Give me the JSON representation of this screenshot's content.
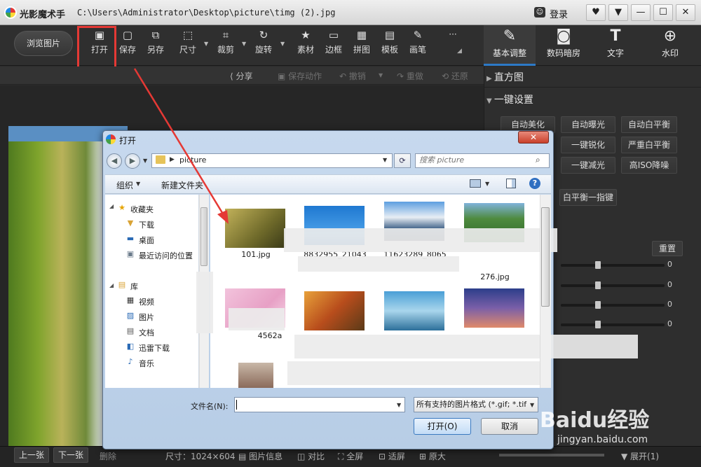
{
  "window": {
    "app_name": "光影魔术手",
    "file_path": "C:\\Users\\Administrator\\Desktop\\picture\\timg (2).jpg",
    "login": "登录",
    "controls": [
      "♥",
      "▼",
      "—",
      "☐",
      "✕"
    ]
  },
  "toolbar": {
    "browse": "浏览图片",
    "tools": [
      {
        "label": "打开",
        "icon": "open-image-icon"
      },
      {
        "label": "保存",
        "icon": "save-icon"
      },
      {
        "label": "另存",
        "icon": "save-as-icon"
      },
      {
        "label": "尺寸",
        "icon": "resize-icon"
      },
      {
        "label": "裁剪",
        "icon": "crop-icon"
      },
      {
        "label": "旋转",
        "icon": "rotate-icon"
      },
      {
        "label": "素材",
        "icon": "material-icon"
      },
      {
        "label": "边框",
        "icon": "border-icon"
      },
      {
        "label": "拼图",
        "icon": "collage-icon"
      },
      {
        "label": "模板",
        "icon": "template-icon"
      },
      {
        "label": "画笔",
        "icon": "brush-icon"
      },
      {
        "label": "···",
        "icon": "more-icon"
      }
    ],
    "right_tabs": [
      {
        "label": "基本调整",
        "icon": "adjust-icon"
      },
      {
        "label": "数码暗房",
        "icon": "camera-icon"
      },
      {
        "label": "文字",
        "icon": "text-icon"
      },
      {
        "label": "水印",
        "icon": "watermark-icon"
      }
    ]
  },
  "subbar": {
    "share": "分享",
    "save_action": "保存动作",
    "undo": "撤销",
    "redo": "重做",
    "restore": "还原"
  },
  "panel": {
    "histogram": "直方图",
    "one_click": "一键设置",
    "buttons": [
      "自动美化",
      "自动曝光",
      "自动白平衡",
      "一键锐化",
      "严重白平衡",
      "一键减光",
      "高ISO降噪",
      "白平衡一指键"
    ],
    "reset": "重置",
    "slider_values": [
      "0",
      "0",
      "0",
      "0"
    ]
  },
  "bottombar": {
    "prev": "上一张",
    "next": "下一张",
    "delete": "删除",
    "size": "尺寸：1024×604",
    "info": "图片信息",
    "compare": "对比",
    "fullscreen": "全屏",
    "fit": "适屏",
    "actual": "原大",
    "expand": "展开(1)"
  },
  "watermark": {
    "brand": "Baidu经验",
    "url": "jingyan.baidu.com"
  },
  "dialog": {
    "title": "打开",
    "close": "✕",
    "path_folder": "picture",
    "search_placeholder": "搜索 picture",
    "organize": "组织",
    "new_folder": "新建文件夹",
    "nav": [
      {
        "label": "收藏夹",
        "icon": "star-icon",
        "indent": false
      },
      {
        "label": "下载",
        "icon": "download-folder-icon",
        "indent": true
      },
      {
        "label": "桌面",
        "icon": "desktop-icon",
        "indent": true
      },
      {
        "label": "最近访问的位置",
        "icon": "recent-icon",
        "indent": true
      },
      {
        "label": "库",
        "icon": "library-icon",
        "indent": false
      },
      {
        "label": "视频",
        "icon": "video-icon",
        "indent": true
      },
      {
        "label": "图片",
        "icon": "pictures-icon",
        "indent": true
      },
      {
        "label": "文档",
        "icon": "documents-icon",
        "indent": true
      },
      {
        "label": "迅雷下载",
        "icon": "thunder-download-icon",
        "indent": true
      },
      {
        "label": "音乐",
        "icon": "music-icon",
        "indent": true
      }
    ],
    "files": [
      {
        "name": "101.jpg",
        "color": "#8a8a3a"
      },
      {
        "name": "8832955_21043",
        "color": "#2a7bc8"
      },
      {
        "name": "11623289_8065",
        "color": "#5d86b5"
      },
      {
        "name": "276.jpg",
        "color": "#3e7a3e"
      },
      {
        "name": "4562a",
        "color": "#e8a9c9"
      },
      {
        "name": "",
        "color": "#c8662a"
      },
      {
        "name": "",
        "color": "#4a9fbf"
      },
      {
        "name": "",
        "color": "#6a4f9a"
      }
    ],
    "filename_label": "文件名(N):",
    "filename_value": "",
    "filetype": "所有支持的图片格式 (*.gif; *.tif",
    "open": "打开(O)",
    "cancel": "取消"
  },
  "colors": {
    "accent": "#2d79c7",
    "highlight_box": "#e53935"
  }
}
